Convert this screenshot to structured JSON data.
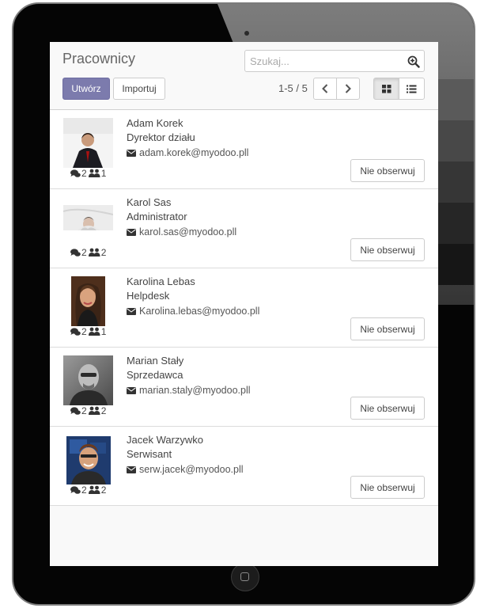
{
  "header": {
    "title": "Pracownicy",
    "search_placeholder": "Szukaj...",
    "create_label": "Utwórz",
    "import_label": "Importuj",
    "pager": "1-5 / 5",
    "active_view": "kanban"
  },
  "colors": {
    "primary": "#7c7bad",
    "frame": "#050505",
    "screen_bg": "#f9f9f9"
  },
  "employees": [
    {
      "name": "Adam Korek",
      "job": "Dyrektor działu",
      "email": "adam.korek@myodoo.pll",
      "messages": "2",
      "followers": "1",
      "unfollow": "Nie obserwuj"
    },
    {
      "name": "Karol Sas",
      "job": "Administrator",
      "email": "karol.sas@myodoo.pll",
      "messages": "2",
      "followers": "2",
      "unfollow": "Nie obserwuj"
    },
    {
      "name": "Karolina Lebas",
      "job": "Helpdesk",
      "email": "Karolina.lebas@myodoo.pll",
      "messages": "2",
      "followers": "1",
      "unfollow": "Nie obserwuj"
    },
    {
      "name": "Marian Stały",
      "job": "Sprzedawca",
      "email": "marian.staly@myodoo.pll",
      "messages": "2",
      "followers": "2",
      "unfollow": "Nie obserwuj"
    },
    {
      "name": "Jacek Warzywko",
      "job": "Serwisant",
      "email": "serw.jacek@myodoo.pll",
      "messages": "2",
      "followers": "2",
      "unfollow": "Nie obserwuj"
    }
  ],
  "icons": {
    "search": "search-icon",
    "prev": "chevron-left-icon",
    "next": "chevron-right-icon",
    "kanban": "grid-icon",
    "list": "list-icon",
    "messages": "comments-icon",
    "followers": "users-icon",
    "email": "envelope-icon"
  }
}
